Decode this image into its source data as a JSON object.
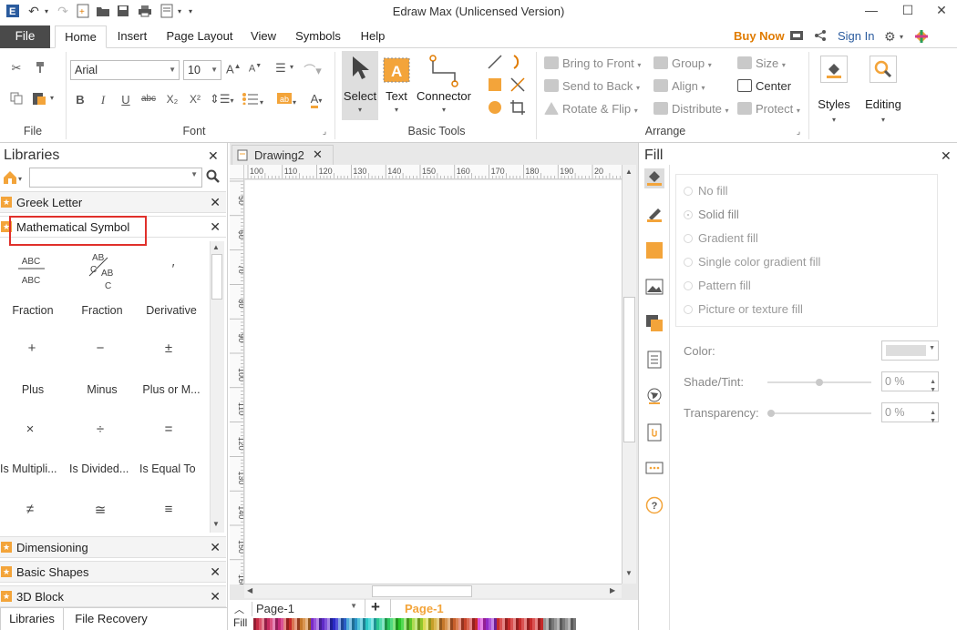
{
  "app": {
    "title": "Edraw Max (Unlicensed Version)"
  },
  "menu": {
    "file": "File",
    "tabs": [
      "Home",
      "Insert",
      "Page Layout",
      "View",
      "Symbols",
      "Help"
    ],
    "active_tab": "Home",
    "buy_now": "Buy Now",
    "sign_in": "Sign In"
  },
  "ribbon": {
    "groups": {
      "file": "File",
      "font": "Font",
      "basic_tools": "Basic Tools",
      "arrange": "Arrange"
    },
    "font_family": "Arial",
    "font_size": "10",
    "tools": {
      "select": "Select",
      "text": "Text",
      "connector": "Connector"
    },
    "arrange": {
      "bring_to_front": "Bring to Front",
      "send_to_back": "Send to Back",
      "rotate_flip": "Rotate & Flip",
      "group": "Group",
      "align": "Align",
      "distribute": "Distribute",
      "size": "Size",
      "center": "Center",
      "protect": "Protect"
    },
    "styles": "Styles",
    "editing": "Editing"
  },
  "libraries": {
    "title": "Libraries",
    "categories_top": [
      "Greek Letter",
      "Mathematical Symbol"
    ],
    "shapes": [
      {
        "label": "Fraction",
        "glyph": "ABC/ABC"
      },
      {
        "label": "Fraction",
        "glyph": "AB/C/AB/C"
      },
      {
        "label": "Derivative",
        "glyph": "′"
      },
      {
        "label": "Plus",
        "glyph": "+"
      },
      {
        "label": "Minus",
        "glyph": "−"
      },
      {
        "label": "Plus or M...",
        "glyph": "±"
      },
      {
        "label": "Is Multipli...",
        "glyph": "×"
      },
      {
        "label": "Is Divided...",
        "glyph": "÷"
      },
      {
        "label": "Is Equal To",
        "glyph": "="
      },
      {
        "label": "",
        "glyph": "≠"
      },
      {
        "label": "",
        "glyph": "≅"
      },
      {
        "label": "",
        "glyph": "≡"
      }
    ],
    "categories_bottom": [
      "Dimensioning",
      "Basic Shapes",
      "3D Block"
    ],
    "bottom_tabs": [
      "Libraries",
      "File Recovery"
    ]
  },
  "document": {
    "tab": "Drawing2",
    "ruler_top": [
      "100",
      "110",
      "120",
      "130",
      "140",
      "150",
      "160",
      "170",
      "180",
      "190",
      "20"
    ],
    "ruler_left": [
      "50",
      "60",
      "70",
      "80",
      "90",
      "100",
      "110",
      "120",
      "130",
      "140",
      "150",
      "160"
    ],
    "page_selector": "Page-1",
    "page_tab": "Page-1",
    "fill_label": "Fill"
  },
  "fill_panel": {
    "title": "Fill",
    "options": [
      "No fill",
      "Solid fill",
      "Gradient fill",
      "Single color gradient fill",
      "Pattern fill",
      "Picture or texture fill"
    ],
    "color_label": "Color:",
    "shade_label": "Shade/Tint:",
    "shade_value": "0 %",
    "transparency_label": "Transparency:",
    "transparency_value": "0 %"
  },
  "colors": {
    "accent": "#f3a43a",
    "file_tab": "#4a4a4a",
    "buy_now": "#e07b00",
    "highlight": "#e0302b"
  }
}
